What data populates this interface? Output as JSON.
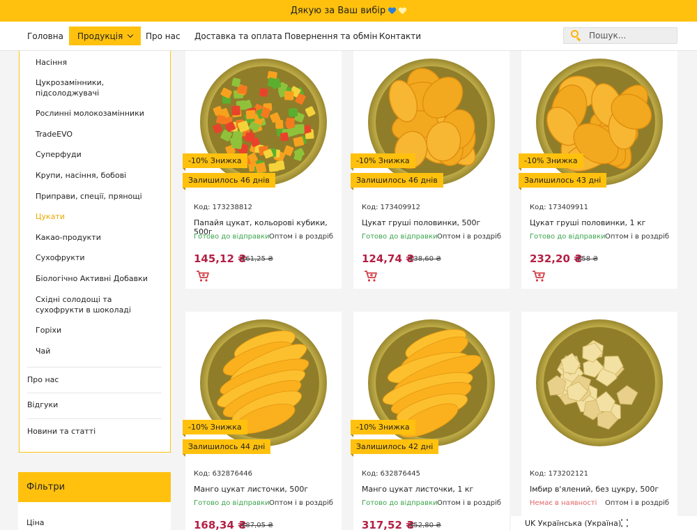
{
  "banner": {
    "text": "Дякую за Ваш вибір"
  },
  "nav": {
    "items": [
      "Головна",
      "Продукція",
      "Про нас",
      "Доставка та оплата",
      "Повернення та обмін",
      "Контакти"
    ],
    "search_placeholder": "Пошук..."
  },
  "sidebar": {
    "categories": [
      "Насіння",
      "Цукрозамінники, підсолоджувачі",
      "Рослинні молокозамінники",
      "TradeEVO",
      "Суперфуди",
      "Крупи, насіння, бобові",
      "Приправи, спеції, прянощі",
      "Цукати",
      "Какао-продукти",
      "Сухофрукти",
      "Біологічно Активні Добавки",
      "Східні солодощі та сухофрукти в шоколаді",
      "Горіхи",
      "Чай"
    ],
    "active_category": "Цукати",
    "links": [
      "Про нас",
      "Відгуки",
      "Новини та статті"
    ]
  },
  "filters": {
    "title": "Фільтри",
    "price_label": "Ціна"
  },
  "products": [
    {
      "code": "Код: 173238812",
      "name": "Папайя цукат, кольорові кубики, 500г",
      "status": "Готово до відправки",
      "mode": "Оптом і в роздріб",
      "price": "145,12 ₴",
      "old_price": "161,25 ₴",
      "discount": "-10% Знижка",
      "left": "Залишилось 46 днів",
      "fruit": "papaya-cubes"
    },
    {
      "code": "Код: 173409912",
      "name": "Цукат груші половинки, 500г",
      "status": "Готово до відправки",
      "mode": "Оптом і в роздріб",
      "price": "124,74 ₴",
      "old_price": "138,60 ₴",
      "discount": "-10% Знижка",
      "left": "Залишилось 46 днів",
      "fruit": "pear-halves"
    },
    {
      "code": "Код: 173409911",
      "name": "Цукат груші половинки, 1 кг",
      "status": "Готово до відправки",
      "mode": "Оптом і в роздріб",
      "price": "232,20 ₴",
      "old_price": "258 ₴",
      "discount": "-10% Знижка",
      "left": "Залишилось 43 дні",
      "fruit": "pear-halves"
    },
    {
      "code": "Код: 632876446",
      "name": "Манго цукат листочки, 500г",
      "status": "Готово до відправки",
      "mode": "Оптом і в роздріб",
      "price": "168,34 ₴",
      "old_price": "187,05 ₴",
      "discount": "-10% Знижка",
      "left": "Залишилось 44 дні",
      "fruit": "mango-slices"
    },
    {
      "code": "Код: 632876445",
      "name": "Манго цукат листочки, 1 кг",
      "status": "Готово до відправки",
      "mode": "Оптом і в роздріб",
      "price": "317,52 ₴",
      "old_price": "352,80 ₴",
      "discount": "-10% Знижка",
      "left": "Залишилось 42 дні",
      "fruit": "mango-slices"
    },
    {
      "code": "Код: 173202121",
      "name": "Імбир в'ялений, без цукру, 500г",
      "status": "Немає в наявності",
      "mode": "Оптом і в роздріб",
      "price": "",
      "old_price": "",
      "discount": "",
      "left": "",
      "fruit": "ginger-pieces"
    }
  ],
  "language": {
    "label": "UK Українська (Україна)"
  },
  "colors": {
    "accent": "#ffc10e",
    "price": "#b41f44",
    "in_stock": "#3aa34c",
    "out_of_stock": "#e06666"
  }
}
